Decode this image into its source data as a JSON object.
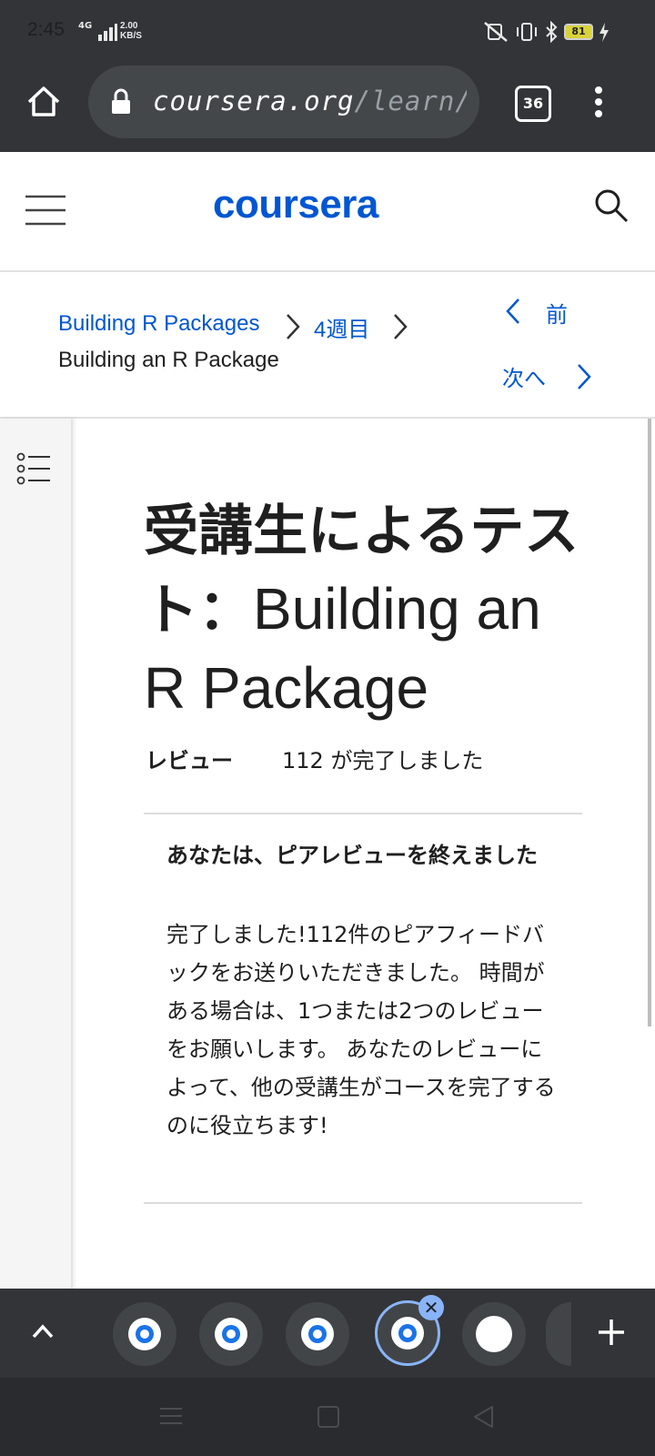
{
  "status_bar": {
    "time": "2:45",
    "network": "4G",
    "speed_value": "2.00",
    "speed_unit": "KB/S",
    "battery": "81"
  },
  "browser": {
    "url_host": "coursera.org",
    "url_path": "/learn/r-pac",
    "tab_count": "36"
  },
  "header": {
    "logo": "coursera"
  },
  "breadcrumb": {
    "course": "Building R Packages",
    "week": "4週目",
    "item": "Building an R Package"
  },
  "nav": {
    "prev_label": "前",
    "next_label": "次へ"
  },
  "main": {
    "title_jp": "受講生によるテスト：",
    "title_en": "Building an R Package",
    "review_label": "レビュー",
    "review_status": "112 が完了しました",
    "notice_heading": "あなたは、ピアレビューを終えました",
    "notice_body": "完了しました!112件のピアフィードバックをお送りいただきました。 時間がある場合は、1つまたは2つのレビューをお願いします。 あなたのレビューによって、他の受講生がコースを完了するのに役立ちます!"
  },
  "colors": {
    "brand": "#0056d2",
    "chrome_dark": "#323437",
    "tab_highlight": "#8ab4f8"
  },
  "icons": [
    "home-icon",
    "lock-icon",
    "menu-dots-icon",
    "hamburger-icon",
    "search-icon",
    "chevron-right-icon",
    "chevron-left-icon",
    "list-icon",
    "chevron-up-icon",
    "plus-icon",
    "close-icon",
    "coursera-favicon-icon"
  ]
}
